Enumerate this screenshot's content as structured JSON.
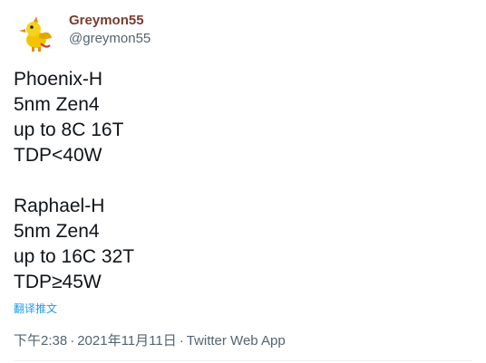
{
  "author": {
    "display_name": "Greymon55",
    "handle": "@greymon55",
    "avatar_icon": "yellow-bird-mascot-icon"
  },
  "tweet": {
    "lines_block1": [
      "Phoenix-H",
      "5nm Zen4",
      "up to 8C 16T",
      "TDP<40W"
    ],
    "lines_block2": [
      "Raphael-H",
      "5nm Zen4",
      "up to 16C 32T",
      "TDP≥45W"
    ],
    "translate_label": "翻译推文"
  },
  "meta": {
    "time": "下午2:38",
    "date": "2021年11月11日",
    "source": "Twitter Web App",
    "separator": "·"
  },
  "colors": {
    "name": "#7b3b2e",
    "secondary": "#536471",
    "link": "#1d9bf0",
    "text": "#0f1419"
  }
}
